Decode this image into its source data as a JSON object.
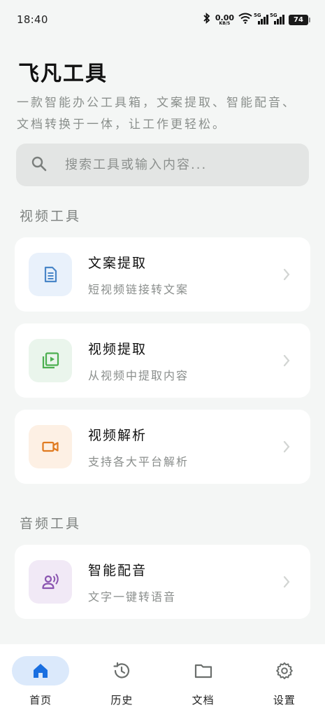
{
  "status_bar": {
    "time": "18:40",
    "net_speed": "0.00",
    "net_unit": "KB/S",
    "signal_1_label": "5G",
    "signal_2_label": "5G",
    "battery": "74"
  },
  "header": {
    "title": "飞凡工具",
    "description": "一款智能办公工具箱，文案提取、智能配音、文档转换于一体，让工作更轻松。"
  },
  "search": {
    "placeholder": "搜索工具或输入内容..."
  },
  "sections": [
    {
      "title": "视频工具",
      "items": [
        {
          "title": "文案提取",
          "subtitle": "短视频链接转文案",
          "icon": "document-icon",
          "color": "#4a86c8",
          "bg": "#e9f1fb"
        },
        {
          "title": "视频提取",
          "subtitle": "从视频中提取内容",
          "icon": "video-library-icon",
          "color": "#4caf50",
          "bg": "#eaf5ec"
        },
        {
          "title": "视频解析",
          "subtitle": "支持各大平台解析",
          "icon": "video-camera-icon",
          "color": "#e07a1f",
          "bg": "#fdf0e4"
        }
      ]
    },
    {
      "title": "音频工具",
      "items": [
        {
          "title": "智能配音",
          "subtitle": "文字一键转语音",
          "icon": "voice-icon",
          "color": "#8a54b0",
          "bg": "#f1e9f6"
        }
      ]
    }
  ],
  "bottom_nav": [
    {
      "label": "首页",
      "icon": "home-icon",
      "active": true
    },
    {
      "label": "历史",
      "icon": "history-icon",
      "active": false
    },
    {
      "label": "文档",
      "icon": "folder-icon",
      "active": false
    },
    {
      "label": "设置",
      "icon": "settings-icon",
      "active": false
    }
  ],
  "colors": {
    "accent": "#1a6fe0",
    "active_nav_bg": "#dbe9fb",
    "background": "#f4f6f5"
  }
}
